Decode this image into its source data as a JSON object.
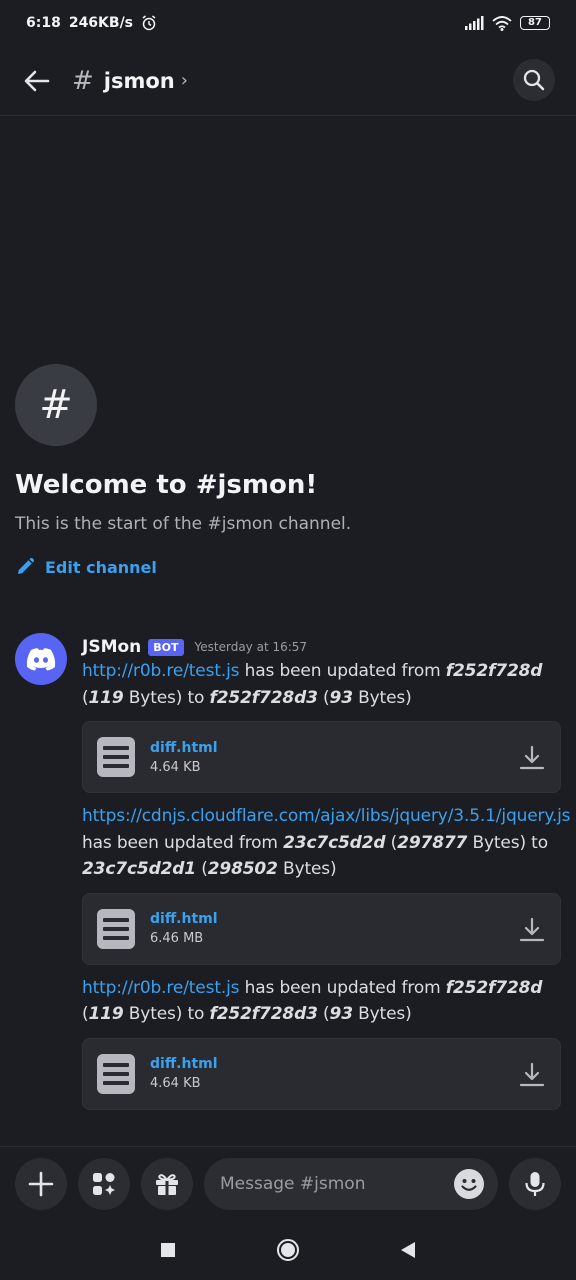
{
  "status_bar": {
    "time": "6:18",
    "speed": "246KB/s",
    "battery": "87"
  },
  "header": {
    "hash": "#",
    "channel_name": "jsmon",
    "chevron": "›"
  },
  "welcome": {
    "icon_symbol": "#",
    "title": "Welcome to #jsmon!",
    "subtitle": "This is the start of the #jsmon channel.",
    "edit_label": "Edit channel"
  },
  "message": {
    "author": "JSMon",
    "badge": "BOT",
    "timestamp": "Yesterday at 16:57",
    "updates": [
      {
        "url": "http://r0b.re/test.js",
        "text_from": " has been updated from ",
        "old_hash": "f252f728d",
        "old_size": "119",
        "text_to": " Bytes) to ",
        "new_hash": "f252f728d3",
        "new_size": "93",
        "text_end": " Bytes)",
        "attachment": {
          "name": "diff.html",
          "size": "4.64 KB"
        }
      },
      {
        "url": "https://cdnjs.cloudflare.com/ajax/libs/jquery/3.5.1/jquery.js",
        "text_from": " has been updated from ",
        "old_hash": "23c7c5d2d",
        "old_size": "297877",
        "text_to": " Bytes) to ",
        "new_hash": "23c7c5d2d1",
        "new_size": "298502",
        "text_end": " Bytes)",
        "attachment": {
          "name": "diff.html",
          "size": "6.46 MB"
        }
      },
      {
        "url": "http://r0b.re/test.js",
        "text_from": " has been updated from ",
        "old_hash": "f252f728d",
        "old_size": "119",
        "text_to": " Bytes) to ",
        "new_hash": "f252f728d3",
        "new_size": "93",
        "text_end": " Bytes)",
        "attachment": {
          "name": "diff.html",
          "size": "4.64 KB"
        }
      }
    ]
  },
  "input": {
    "placeholder": "Message #jsmon"
  },
  "icons": [
    "back-arrow-icon",
    "search-icon",
    "pencil-icon",
    "discord-logo-icon",
    "file-icon",
    "download-icon",
    "plus-icon",
    "apps-icon",
    "gift-icon",
    "emoji-icon",
    "microphone-icon",
    "nav-square-icon",
    "nav-home-icon",
    "nav-back-icon"
  ],
  "colors": {
    "background": "#1c1d22",
    "link": "#3aa0f0",
    "blurple": "#5865f2"
  }
}
